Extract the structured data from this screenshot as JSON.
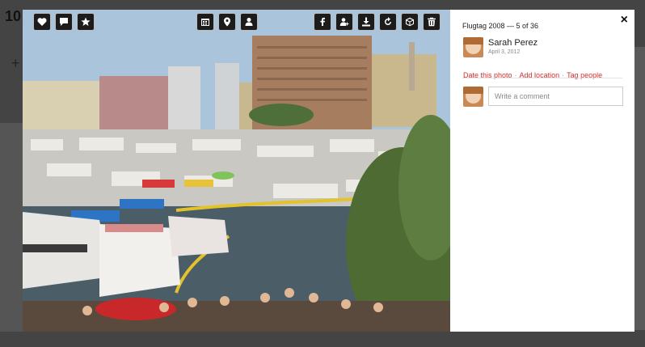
{
  "background": {
    "logo_text": "10",
    "plus_icon": "+"
  },
  "viewer": {
    "toolbar_left": [
      {
        "icon": "heart-icon"
      },
      {
        "icon": "comment-icon"
      },
      {
        "icon": "star-icon"
      }
    ],
    "toolbar_middle": [
      {
        "icon": "calendar-icon"
      },
      {
        "icon": "location-pin-icon"
      },
      {
        "icon": "person-icon"
      }
    ],
    "toolbar_right": [
      {
        "icon": "facebook-icon"
      },
      {
        "icon": "share-person-icon"
      },
      {
        "icon": "download-icon"
      },
      {
        "icon": "rotate-icon"
      },
      {
        "icon": "cube-icon"
      },
      {
        "icon": "trash-icon"
      }
    ]
  },
  "panel": {
    "close_label": "×",
    "album_title": "Flugtag 2008 — 5 of 36",
    "author_name": "Sarah Perez",
    "date": "April 3, 2012",
    "links": [
      "Date this photo",
      "Add location",
      "Tag people"
    ],
    "comment_placeholder": "Write a comment"
  }
}
